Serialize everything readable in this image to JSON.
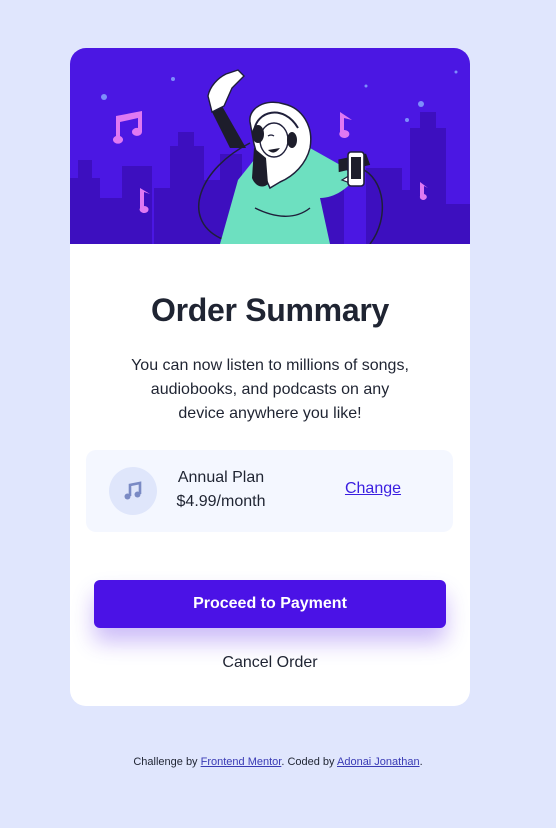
{
  "order": {
    "title": "Order Summary",
    "description": "You can now listen to millions of songs, audiobooks, and podcasts on any device anywhere you like!",
    "plan": {
      "name": "Annual Plan",
      "price": "$4.99/month",
      "change_label": "Change",
      "icon": "music-note-icon"
    },
    "proceed_label": "Proceed to Payment",
    "cancel_label": "Cancel Order"
  },
  "footer": {
    "challenge_prefix": "Challenge by",
    "challenge_link": "Frontend Mentor",
    "coded_prefix": ". Coded by",
    "author_link": "Adonai Jonathan",
    "suffix": "."
  },
  "colors": {
    "background": "#e0e6fd",
    "hero": "#4b17e3",
    "accent": "#4b12e6",
    "plan_box": "#f4f7ff",
    "text": "#1f2432"
  }
}
